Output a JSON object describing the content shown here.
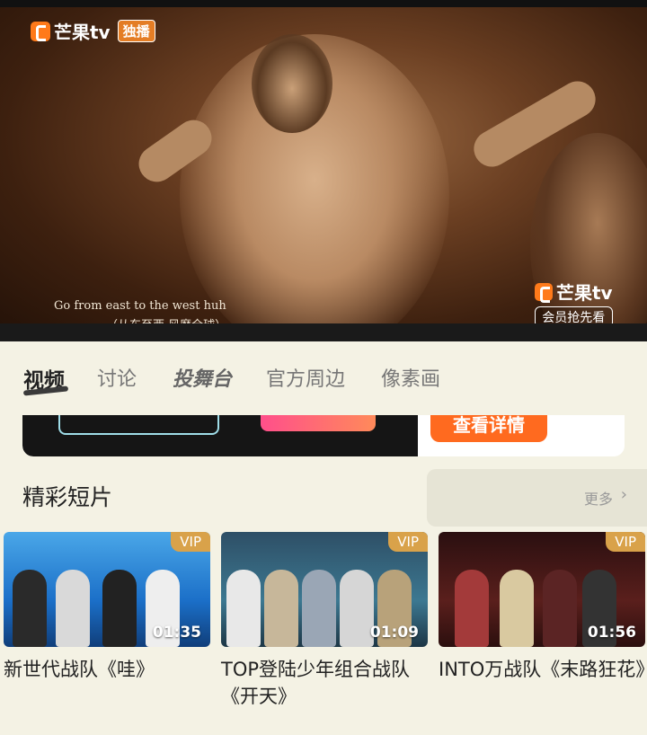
{
  "video": {
    "logo_text": "芒果tv",
    "logo_badge": "独播",
    "subtitle_en": "Go from east to the west huh",
    "subtitle_zh": "（从东至西 风靡全球）",
    "watermark_brand": "芒果tv",
    "watermark_vip": "会员抢先看"
  },
  "tabs": [
    {
      "label": "视频",
      "active": true
    },
    {
      "label": "讨论",
      "active": false
    },
    {
      "label": "投舞台",
      "active": false
    },
    {
      "label": "官方周边",
      "active": false
    },
    {
      "label": "像素画",
      "active": false
    }
  ],
  "banner": {
    "button_label": "查看详情"
  },
  "section": {
    "title": "精彩短片",
    "more_label": "更多",
    "more_icon": "chevron-right-icon"
  },
  "cards": [
    {
      "title": "新世代战队《哇》",
      "duration": "01:35",
      "badge": "VIP"
    },
    {
      "title": "TOP登陆少年组合战队《开天》",
      "duration": "01:09",
      "badge": "VIP"
    },
    {
      "title": "INTO万战队《末路狂花》",
      "duration": "01:56",
      "badge": "VIP"
    }
  ],
  "colors": {
    "background": "#f4f2e4",
    "accent": "#ff6a1f",
    "vip": "#d9a24a"
  }
}
